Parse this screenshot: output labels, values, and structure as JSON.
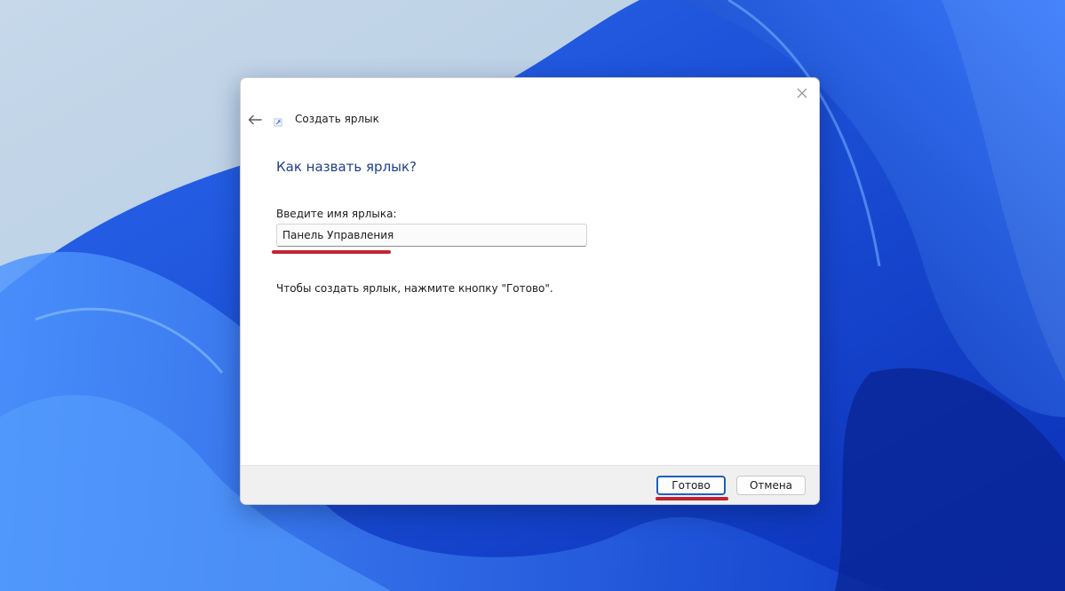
{
  "dialog": {
    "title": "Создать ярлык",
    "heading": "Как назвать ярлык?",
    "field_label": "Введите имя ярлыка:",
    "field_value": "Панель Управления",
    "instruction": "Чтобы создать ярлык, нажмите кнопку \"Готово\".",
    "finish_label": "Готово",
    "cancel_label": "Отмена"
  },
  "icons": {
    "back": "back-arrow-icon",
    "close": "close-icon",
    "title": "shortcut-icon"
  },
  "colors": {
    "heading": "#1f3f8c",
    "annotation_underline": "#c22333",
    "default_button_border": "#1f5fbf"
  }
}
